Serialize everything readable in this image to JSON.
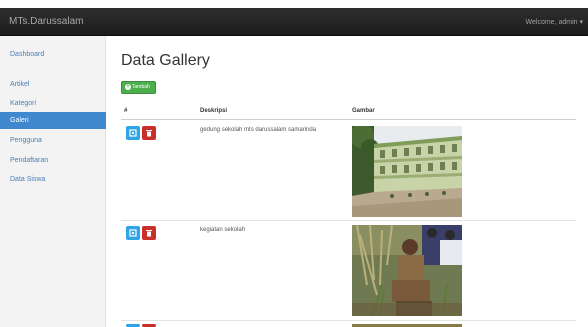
{
  "navbar": {
    "brand": "MTs.Darussalam",
    "welcome": "Welcome, admin ▾"
  },
  "sidebar": {
    "items": [
      {
        "label": "Dashboard",
        "active": false
      },
      {
        "label": "Artikel",
        "active": false
      },
      {
        "label": "Kategori",
        "active": false
      },
      {
        "label": "Galeri",
        "active": true
      },
      {
        "label": "Pengguna",
        "active": false
      },
      {
        "label": "Pendaftaran",
        "active": false
      },
      {
        "label": "Data Siswa",
        "active": false
      }
    ]
  },
  "main": {
    "title": "Data Gallery",
    "add_button": "Tambah",
    "table": {
      "headers": [
        "#",
        "Deskripsi",
        "Gambar"
      ],
      "rows": [
        {
          "deskripsi": "gedung sekolah mts darussalam samarinda",
          "image": "school-building-photo"
        },
        {
          "deskripsi": "kegiatan sekolah",
          "image": "school-activity-photo"
        }
      ]
    }
  },
  "colors": {
    "navbar": "#222222",
    "active_nav": "#3f88cf",
    "add": "#4cae4c",
    "edit": "#2fa4e7",
    "delete": "#c9302c",
    "link": "#4a7fb5"
  }
}
